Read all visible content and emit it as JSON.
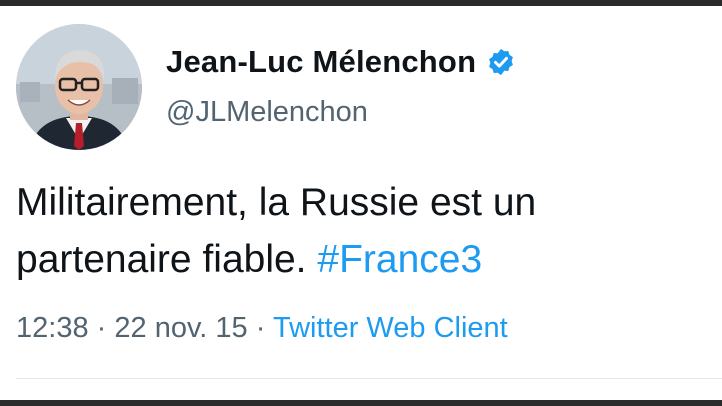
{
  "tweet": {
    "author": {
      "display_name": "Jean-Luc Mélenchon",
      "handle": "@JLMelenchon",
      "verified": true,
      "avatar_icon": "profile-photo-icon"
    },
    "text_plain": "Militairement, la Russie est un partenaire fiable.",
    "hashtag": "#France3",
    "time": "12:38",
    "separator": "·",
    "date": "22 nov. 15",
    "client": "Twitter Web Client"
  },
  "colors": {
    "link": "#1d9bf0",
    "text": "#0f1419",
    "secondary": "#536471",
    "verified_badge": "#1d9bf0",
    "frame": "#2b2b2b"
  }
}
